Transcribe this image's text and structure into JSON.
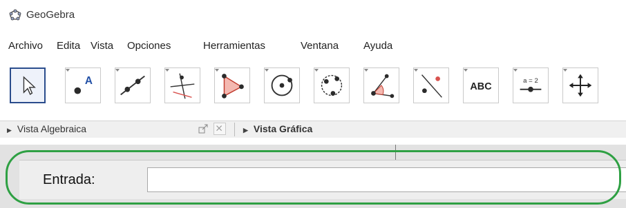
{
  "window": {
    "title": "GeoGebra"
  },
  "menu": [
    "Archivo",
    "Edita",
    "Vista",
    "Opciones",
    "Herramientas",
    "Ventana",
    "Ayuda"
  ],
  "toolbar": {
    "tools": [
      {
        "icon": "move-pointer-icon",
        "selected": true
      },
      {
        "icon": "new-point-icon"
      },
      {
        "icon": "line-through-two-points-icon"
      },
      {
        "icon": "perpendicular-line-icon"
      },
      {
        "icon": "polygon-icon"
      },
      {
        "icon": "circle-center-point-icon"
      },
      {
        "icon": "circle-three-points-icon"
      },
      {
        "icon": "angle-icon"
      },
      {
        "icon": "reflect-about-line-icon"
      },
      {
        "icon": "text-icon",
        "label": "ABC"
      },
      {
        "icon": "slider-icon",
        "label": "a = 2"
      },
      {
        "icon": "move-graphics-view-icon"
      }
    ]
  },
  "views": {
    "algebra": "Vista Algebraica",
    "graphics": "Vista Gráfica"
  },
  "input": {
    "label": "Entrada:",
    "value": ""
  },
  "colors": {
    "highlight": "#2ea043",
    "selected_border": "#2a4c8c",
    "accent": "#d9534f"
  }
}
